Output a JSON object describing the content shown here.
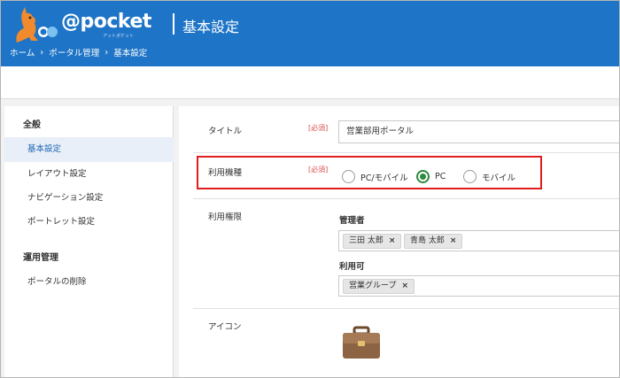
{
  "header": {
    "logo_text": "@pocket",
    "logo_sub": "アットポケット",
    "title": "基本設定",
    "breadcrumb": [
      "ホーム",
      "ポータル管理",
      "基本設定"
    ],
    "breadcrumb_separator": "›"
  },
  "sidebar": {
    "sections": [
      {
        "heading": "全般",
        "items": [
          "基本設定",
          "レイアウト設定",
          "ナビゲーション設定",
          "ポートレット設定"
        ],
        "active": "基本設定"
      },
      {
        "heading": "運用管理",
        "items": [
          "ポータルの削除"
        ]
      }
    ]
  },
  "form": {
    "title_row": {
      "label": "タイトル",
      "required": "[必須]",
      "value": "営業部用ポータル"
    },
    "device_row": {
      "label": "利用機種",
      "required": "[必須]",
      "options": [
        "PC/モバイル",
        "PC",
        "モバイル"
      ],
      "selected": "PC"
    },
    "permission_row": {
      "label": "利用権限",
      "admin_label": "管理者",
      "admins": [
        "三田 太郎",
        "青島 太郎"
      ],
      "users_label": "利用可",
      "users": [
        "営業グループ"
      ],
      "remove_glyph": "×"
    },
    "icon_row": {
      "label": "アイコン",
      "icon": "briefcase-icon"
    }
  },
  "colors": {
    "header_bg": "#1e74c6",
    "highlight_border": "#e01e1e",
    "radio_checked": "#2e8b3d",
    "required_text": "#d9534f"
  }
}
